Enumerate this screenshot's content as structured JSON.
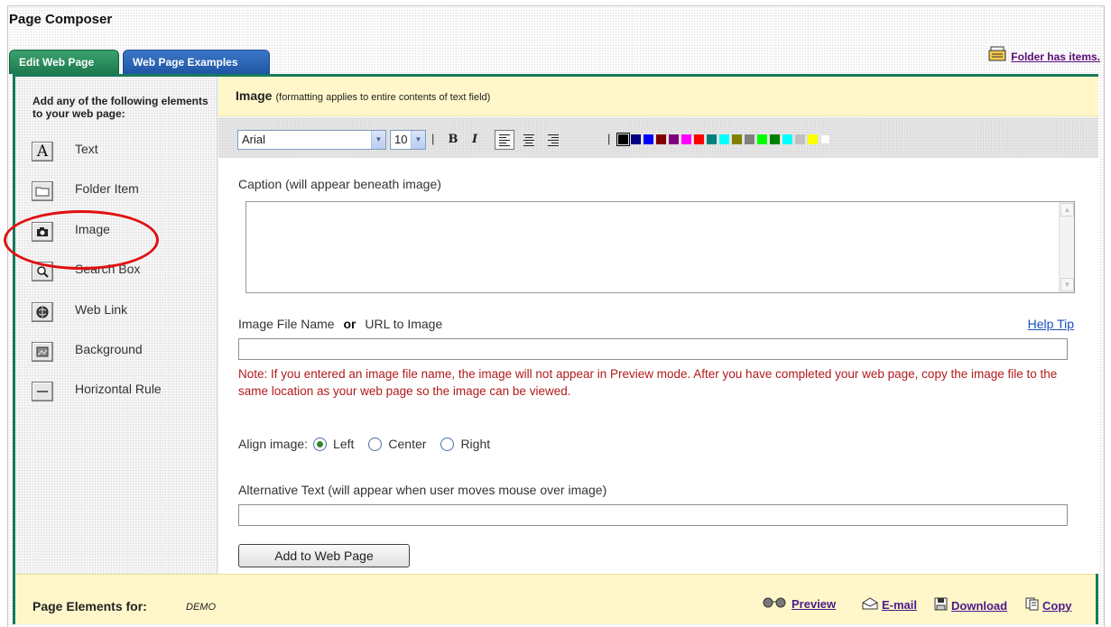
{
  "app": {
    "title": "Page Composer"
  },
  "tabs": [
    {
      "label": "Edit Web Page",
      "active": true
    },
    {
      "label": "Web Page Examples",
      "active": false
    }
  ],
  "folder_status": {
    "label": "Folder has items.",
    "icon": "folder-items-icon"
  },
  "left_panel": {
    "heading": "Add any of the following elements to your web page:",
    "items": [
      {
        "label": "Text",
        "icon": "text-A-icon"
      },
      {
        "label": "Folder Item",
        "icon": "folder-icon"
      },
      {
        "label": "Image",
        "icon": "camera-icon"
      },
      {
        "label": "Search Box",
        "icon": "magnifier-icon"
      },
      {
        "label": "Web Link",
        "icon": "globe-icon"
      },
      {
        "label": "Background",
        "icon": "background-icon"
      },
      {
        "label": "Horizontal Rule",
        "icon": "horizontal-rule-icon"
      }
    ]
  },
  "image_form": {
    "title": "Image",
    "subtitle": "(formatting applies to entire contents of text field)",
    "toolbar": {
      "font": "Arial",
      "size": "10",
      "bold": "B",
      "italic": "I",
      "separator": "|",
      "colors": [
        "#000000",
        "#000080",
        "#0000ff",
        "#800000",
        "#800080",
        "#ff00ff",
        "#ff0000",
        "#008080",
        "#00ffff",
        "#808000",
        "#808080",
        "#00ff00",
        "#008000",
        "#00ffff",
        "#c0c0c0",
        "#ffff00",
        "#ffffff"
      ]
    },
    "caption_label": "Caption (will appear beneath image)",
    "caption_value": "",
    "file_label_part1": "Image File Name",
    "file_label_or": "or",
    "file_label_part2": "URL to Image",
    "help_tip": "Help Tip",
    "file_value": "",
    "note": "Note: If you entered an image file name, the image will not appear in Preview mode. After you have completed your web page, copy the image file to the same location as your web page so the image can be viewed.",
    "align_label": "Align image:",
    "align_options": [
      {
        "label": "Left",
        "checked": true
      },
      {
        "label": "Center",
        "checked": false
      },
      {
        "label": "Right",
        "checked": false
      }
    ],
    "alt_label": "Alternative Text (will appear when user moves mouse over image)",
    "alt_value": "",
    "add_button": "Add to Web Page"
  },
  "bottom_bar": {
    "label": "Page Elements for:",
    "name": "DEMO",
    "actions": [
      {
        "label": "Preview",
        "icon": "glasses-icon"
      },
      {
        "label": "E-mail",
        "icon": "email-icon"
      },
      {
        "label": "Download",
        "icon": "floppy-disk-icon"
      },
      {
        "label": "Copy",
        "icon": "copy-icon"
      }
    ]
  }
}
